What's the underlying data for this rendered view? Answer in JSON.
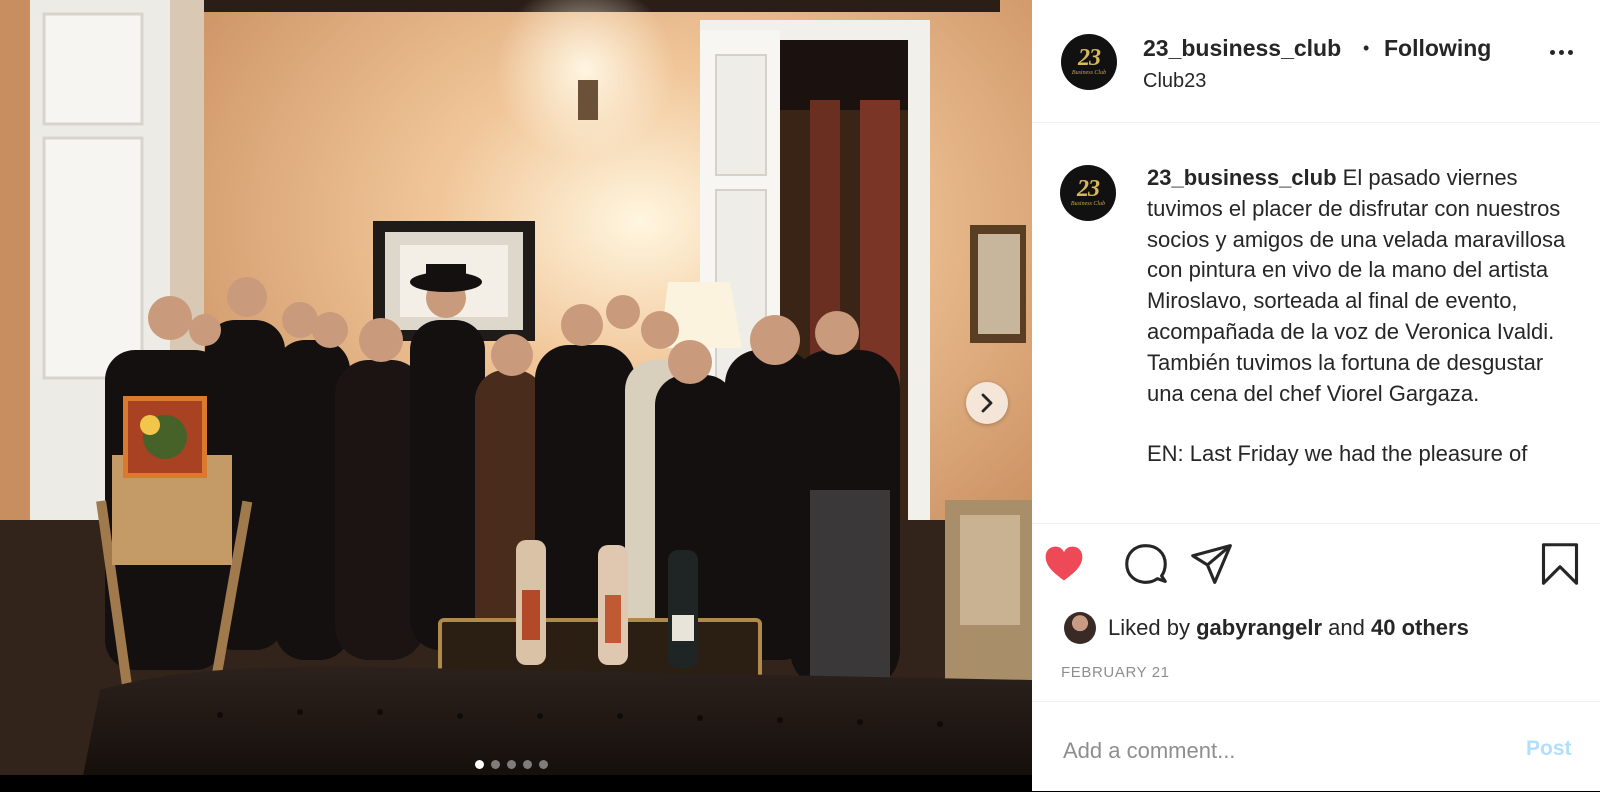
{
  "header": {
    "username": "23_business_club",
    "separator": "•",
    "follow_status": "Following",
    "location": "Club23"
  },
  "avatar": {
    "number": "23",
    "label": "Business Club"
  },
  "caption": {
    "username": "23_business_club",
    "text": "El pasado viernes tuvimos el placer de disfrutar con nuestros socios y amigos de una velada maravillosa con pintura en vivo de la mano del artista Miroslavo, sorteada al final de evento, acompañada de la voz de Veronica Ivaldi. También tuvimos la fortuna de desgustar una cena del chef Viorel Gargaza.",
    "text_en": "EN: Last Friday we had the pleasure of"
  },
  "likes": {
    "prefix": "Liked by",
    "user": "gabyrangelr",
    "joiner": "and",
    "others": "40 others"
  },
  "date": "FEBRUARY 21",
  "comment": {
    "placeholder": "Add a comment...",
    "post_label": "Post"
  },
  "carousel": {
    "total_slides": 5,
    "active_index": 0
  },
  "colors": {
    "like_red": "#ed4956",
    "post_disabled_blue": "#b2dffc",
    "text": "#262626",
    "muted": "#8e8e8e",
    "avatar_gold": "#d8b85a"
  },
  "icons": {
    "like": "heart-filled-icon",
    "comment": "comment-bubble-icon",
    "share": "paper-plane-icon",
    "save": "bookmark-icon",
    "next": "chevron-right-icon",
    "more": "more-dots-icon"
  }
}
